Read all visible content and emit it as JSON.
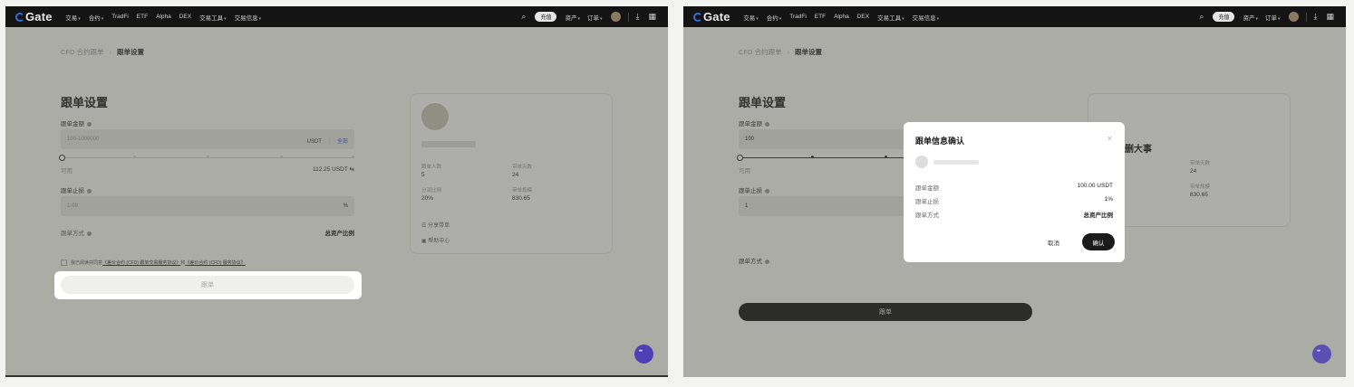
{
  "nav": {
    "logo": "Gate",
    "items": [
      {
        "label": "交易",
        "caret": true
      },
      {
        "label": "合约",
        "caret": true
      },
      {
        "label": "TradFi",
        "caret": false
      },
      {
        "label": "ETF",
        "caret": false
      },
      {
        "label": "Alpha",
        "caret": false
      },
      {
        "label": "DEX",
        "caret": false
      },
      {
        "label": "交易工具",
        "caret": true
      },
      {
        "label": "交易信息",
        "caret": true
      }
    ],
    "deposit": "充值",
    "assets": "资产",
    "orders": "订单"
  },
  "breadcrumb": {
    "parent": "CFD 合约跟单",
    "current": "跟单设置"
  },
  "form": {
    "title": "跟单设置",
    "amount_label": "跟单金额",
    "amount_placeholder": "100-1000000",
    "amount_value": "100",
    "amount_unit": "USDT",
    "amount_all": "全部",
    "available_label": "可用",
    "available_value": "112.25 USDT",
    "stop_loss_label": "跟单止损",
    "stop_loss_placeholder": "1-99",
    "stop_loss_value": "1",
    "stop_loss_unit": "%",
    "mode_label": "跟单方式",
    "mode_value": "总资产比例",
    "agreement_prefix": "我已阅读并同意",
    "agreement_link1": "《差价合约 (CFD) 跟单交易服务协议》",
    "agreement_and": "和",
    "agreement_link2": "《差价合约 (CFD) 服务协议》",
    "submit_label": "跟单"
  },
  "trader_card": {
    "name_partial": "删大事",
    "stats": [
      {
        "label": "跟单人数",
        "value": "5"
      },
      {
        "label": "带单天数",
        "value": "24"
      },
      {
        "label": "分润比例",
        "value": "20%"
      },
      {
        "label": "带单规模",
        "value": "830.65"
      }
    ],
    "links": [
      "分享带单",
      "帮助中心"
    ]
  },
  "modal": {
    "title": "跟单信息确认",
    "rows": [
      {
        "label": "跟单金额",
        "value": "100.00 USDT"
      },
      {
        "label": "跟单止损",
        "value": "1%"
      },
      {
        "label": "跟单方式",
        "value": "总资产比例"
      }
    ],
    "cancel": "取消",
    "confirm": "确认"
  },
  "colors": {
    "accent": "#2f6be0",
    "dark_button": "#1b1b1b",
    "chat": "#4f3eb5"
  }
}
